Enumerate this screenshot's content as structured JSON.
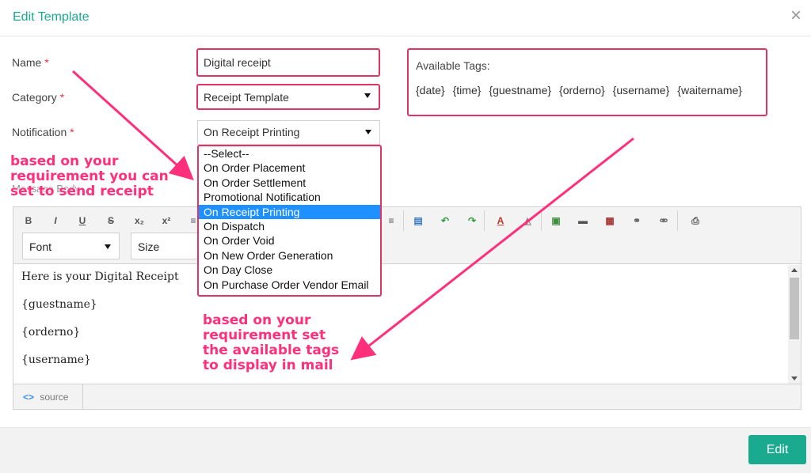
{
  "modal": {
    "title": "Edit Template",
    "close_glyph": "×"
  },
  "form": {
    "name_label": "Name",
    "category_label": "Category",
    "notification_label": "Notification",
    "required_mark": "*",
    "name_value": "Digital receipt",
    "category_value": "Receipt Template",
    "notification_value": "On Receipt Printing",
    "message_body_label": "Message Body"
  },
  "notification_options": [
    "--Select--",
    "On Order Placement",
    "On Order Settlement",
    "Promotional Notification",
    "On Receipt Printing",
    "On Dispatch",
    "On Order Void",
    "On New Order Generation",
    "On Day Close",
    "On Purchase Order Vendor Email"
  ],
  "notification_selected_index": 4,
  "tags": {
    "title": "Available Tags:",
    "items": [
      "{date}",
      "{time}",
      "{guestname}",
      "{orderno}",
      "{username}",
      "{waitername}"
    ]
  },
  "editor": {
    "font_label": "Font",
    "size_label": "Size",
    "lines": [
      "Here is your Digital Receipt",
      "{guestname}",
      "{orderno}",
      "{username}"
    ],
    "source_label": "source",
    "source_icon": "<>",
    "toolbar": [
      "B",
      "I",
      "U",
      "S",
      "x₂",
      "x²"
    ]
  },
  "annotations": {
    "left": [
      "based on your",
      "requirement you can",
      "set to send receipt"
    ],
    "bottom": [
      "based on your",
      "requirement set",
      "the available tags",
      "to display in mail"
    ]
  },
  "actions": {
    "edit_label": "Edit"
  },
  "colors": {
    "accent": "#1aaa8f",
    "highlight": "#e23464",
    "annotation": "#ff2f7b",
    "selection": "#1e90ff"
  }
}
